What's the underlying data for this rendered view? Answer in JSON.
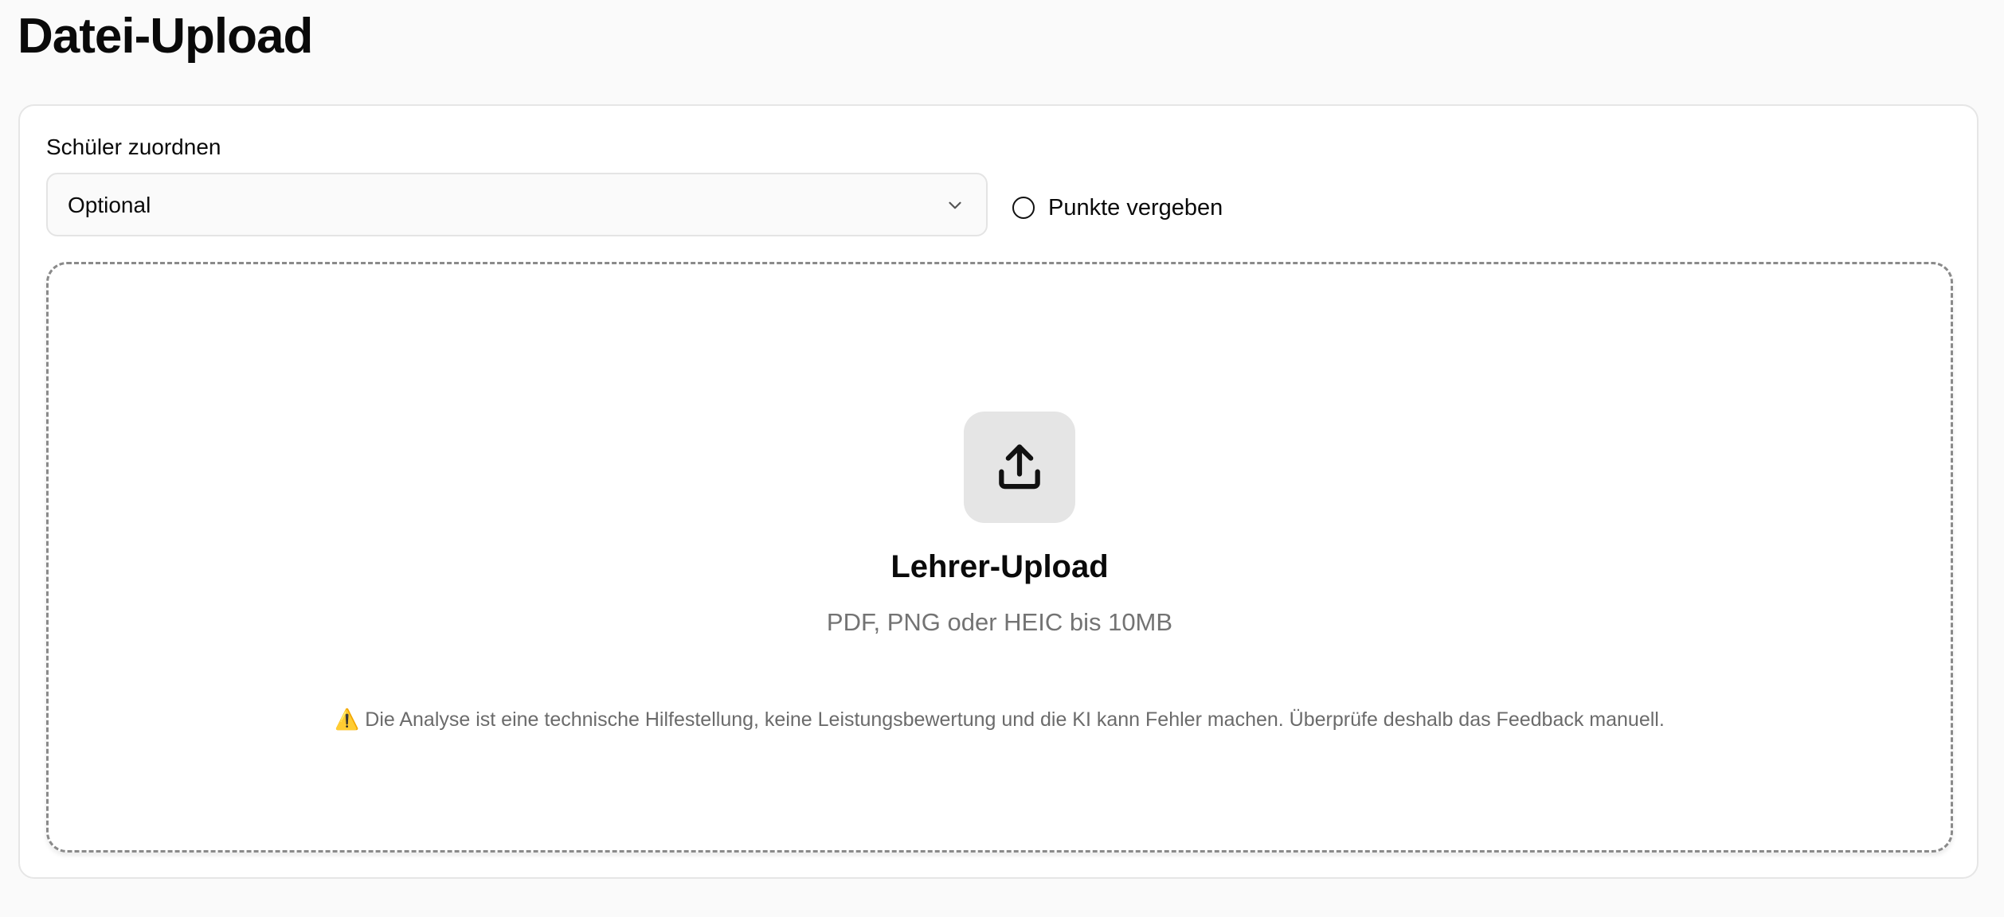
{
  "page": {
    "title": "Datei-Upload"
  },
  "form": {
    "student_label": "Schüler zuordnen",
    "student_select_value": "Optional",
    "points_label": "Punkte vergeben",
    "points_checked": false
  },
  "dropzone": {
    "icon": "upload-icon",
    "title": "Lehrer-Upload",
    "subtitle": "PDF, PNG oder HEIC bis 10MB",
    "note": "⚠️ Die Analyse ist eine technische Hilfestellung, keine Leistungsbewertung und die KI kann Fehler machen. Überprüfe deshalb das Feedback manuell."
  },
  "colors": {
    "background": "#fafafa",
    "card": "#ffffff",
    "muted_text": "#737373",
    "icon_box": "#e5e5e5"
  }
}
